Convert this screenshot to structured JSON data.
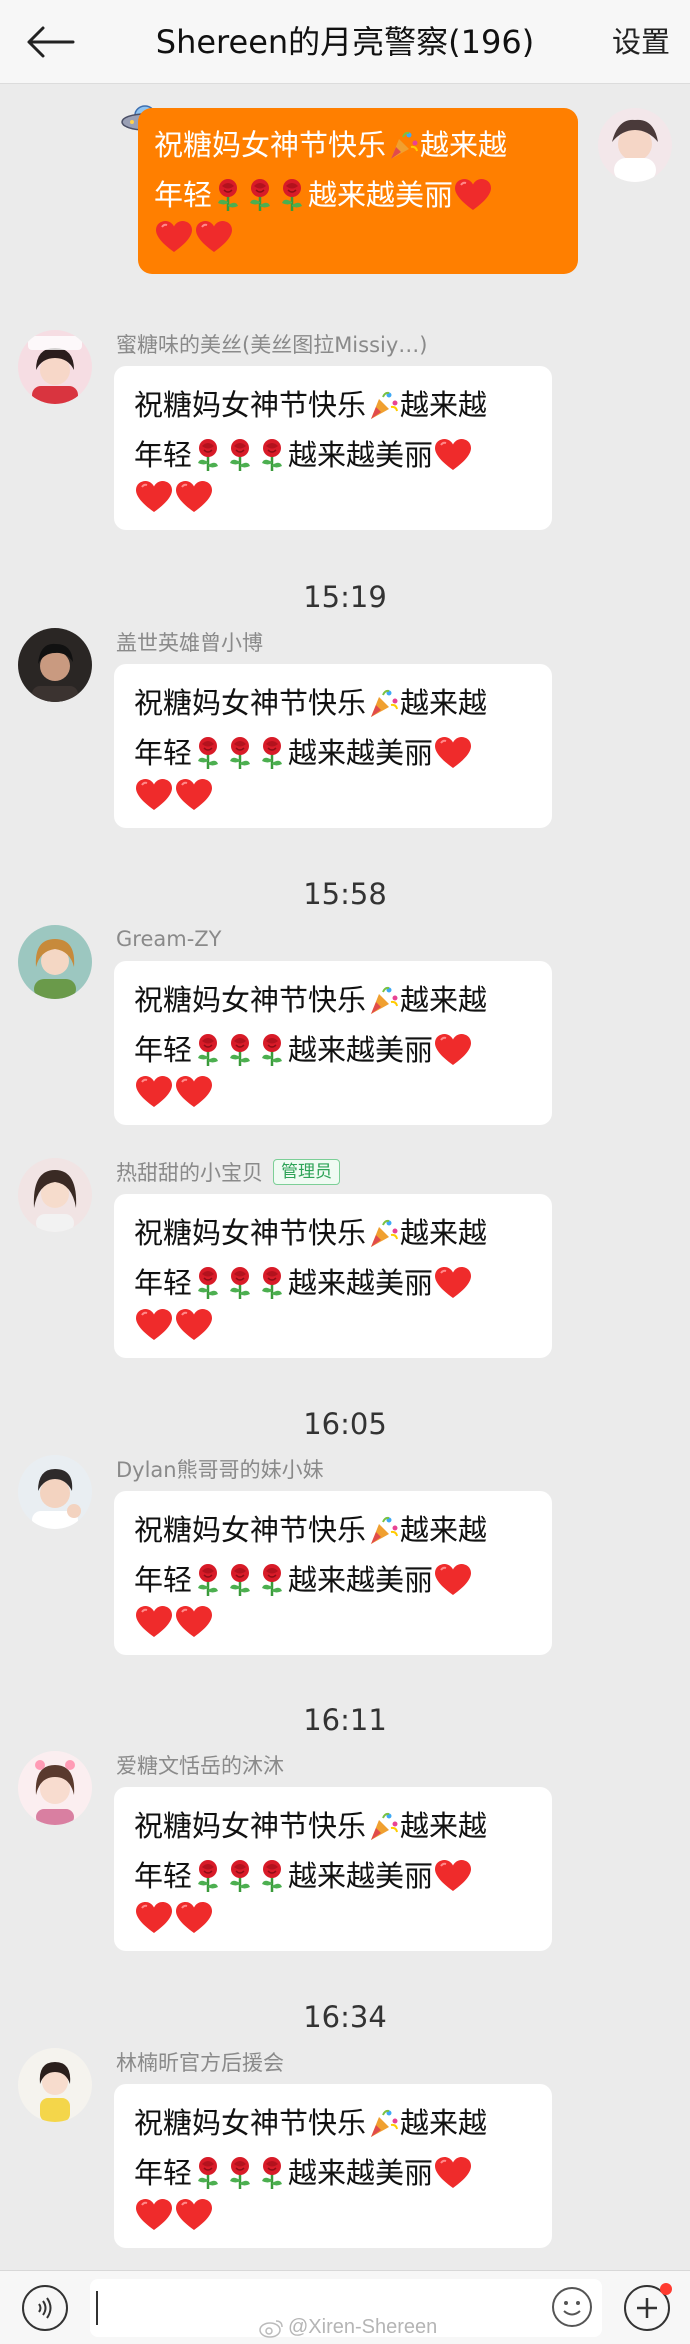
{
  "header": {
    "title": "Shereen的月亮警察(196)",
    "settings_label": "设置"
  },
  "greeting": {
    "line1": "祝糖妈女神节快乐",
    "line1_tail": "越来越",
    "line2_head": "年轻",
    "line2_tail": "越来越美丽"
  },
  "timestamps": [
    "15:19",
    "15:58",
    "16:05",
    "16:11",
    "16:34"
  ],
  "messages": [
    {
      "sender": "蜜糖味的美丝(美丝图拉Missiy…)"
    },
    {
      "sender": "盖世英雄曾小博"
    },
    {
      "sender": "Gream-ZY"
    },
    {
      "sender": "热甜甜的小宝贝",
      "badge": "管理员"
    },
    {
      "sender": "Dylan熊哥哥的妹小妹"
    },
    {
      "sender": "爱糖文恬岳的沐沐"
    },
    {
      "sender": "林楠昕官方后援会"
    }
  ],
  "watermark": "@Xiren-Shereen",
  "colors": {
    "self_bubble": "#ff7f00",
    "background": "#ebebeb",
    "admin_badge": "#2ea357",
    "notify_dot": "#ff3b30"
  },
  "icons": [
    "back-arrow-icon",
    "party-popper-icon",
    "rose-icon",
    "heart-icon",
    "ufo-icon",
    "voice-icon",
    "emoji-icon",
    "plus-icon",
    "weibo-icon"
  ]
}
